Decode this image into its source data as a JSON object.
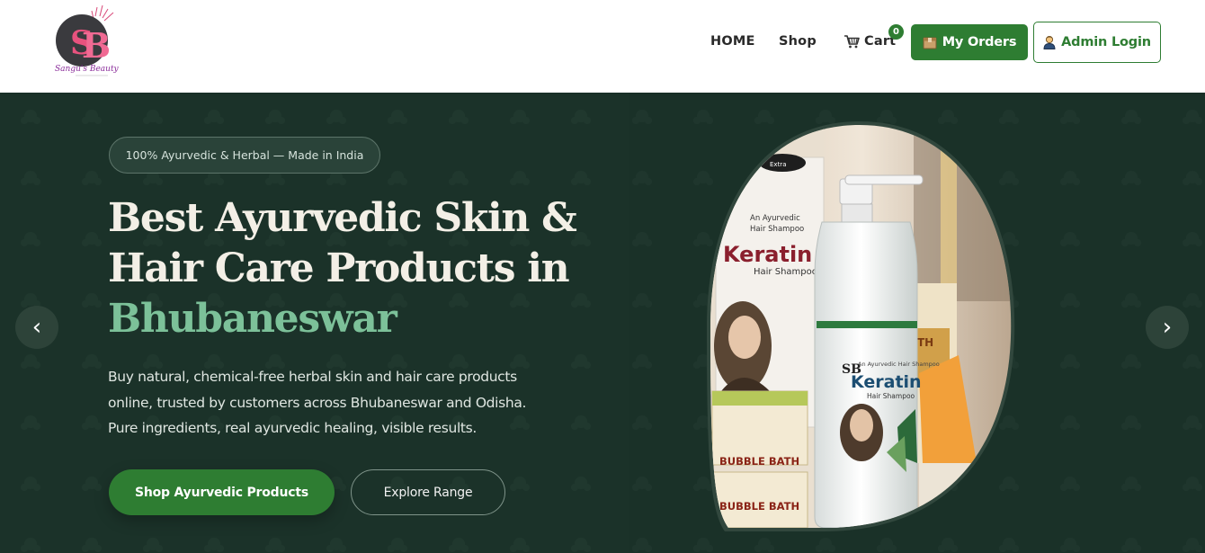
{
  "header": {
    "logo_text": "Sangu's Beauty",
    "logo_monogram": "SB",
    "nav": {
      "home": "HOME",
      "shop": "Shop",
      "cart": "Cart",
      "cart_count": "0",
      "my_orders": "My Orders",
      "admin_login": "Admin Login"
    }
  },
  "hero": {
    "badge": "100% Ayurvedic & Herbal — Made in India",
    "headline_line1": "Best Ayurvedic Skin &",
    "headline_line2": "Hair Care Products in",
    "headline_accent": "Bhubaneswar",
    "description_line1": "Buy natural, chemical-free herbal skin and hair care products",
    "description_line2": "online, trusted by customers across Bhubaneswar and Odisha.",
    "description_line3": "Pure ingredients, real ayurvedic healing, visible results.",
    "primary_cta": "Shop Ayurvedic Products",
    "secondary_cta": "Explore Range",
    "prev_arrow": "‹",
    "next_arrow": "›",
    "product_image": {
      "box_label_small": "An Ayurvedic Hair Shampoo",
      "box_brand": "Keratin",
      "box_sub": "Hair Shampoo",
      "bottle_label_small": "An Ayurvedic Hair Shampoo",
      "bottle_brand": "Keratin",
      "bottle_sub": "Hair Shampoo",
      "bottle_monogram": "SB",
      "soap_label_1": "BUBBLE BATH",
      "soap_label_2": "BUBBLE BATH",
      "soap_side": "TH",
      "box_top_tag": "Extra"
    }
  },
  "colors": {
    "hero_bg": "#1b3229",
    "brand_green": "#2e7d32",
    "accent_green": "#7cc199",
    "headline": "#f3efe6"
  },
  "icons": [
    "cart-icon",
    "orders-box-icon",
    "admin-user-icon",
    "chevron-left-icon",
    "chevron-right-icon"
  ]
}
